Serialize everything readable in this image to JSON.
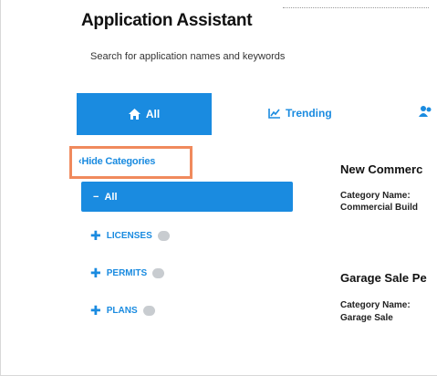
{
  "header": {
    "title": "Application Assistant",
    "subtitle": "Search for application names and keywords"
  },
  "tabs": [
    {
      "icon": "home-icon",
      "label": "All",
      "active": true
    },
    {
      "icon": "trending-chart-icon",
      "label": "Trending",
      "active": false
    },
    {
      "icon": "user-icon",
      "label": "",
      "active": false
    }
  ],
  "categories": {
    "toggle_label": "Hide Categories",
    "all_label": "All",
    "items": [
      {
        "label": "LICENSES"
      },
      {
        "label": "PERMITS"
      },
      {
        "label": "PLANS"
      }
    ]
  },
  "results": [
    {
      "title": "New Commerc",
      "meta_label": "Category Name:",
      "meta_value": "Commercial Build"
    },
    {
      "title": "Garage Sale Pe",
      "meta_label": "Category Name:",
      "meta_value": "Garage Sale"
    }
  ],
  "colors": {
    "accent": "#1a8be0",
    "highlight": "#f08a5d"
  }
}
